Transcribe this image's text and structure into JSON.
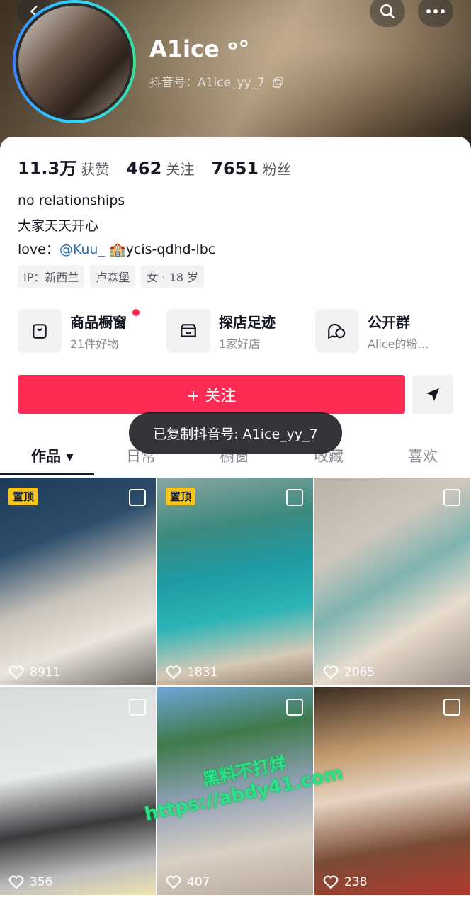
{
  "profile": {
    "name": "A1ice ᵒ°",
    "uid_label": "抖音号：",
    "uid": "A1ice_yy_7",
    "stats": [
      {
        "num": "11.3万",
        "label": "获赞"
      },
      {
        "num": "462",
        "label": "关注"
      },
      {
        "num": "7651",
        "label": "粉丝"
      }
    ],
    "bio_line1": "no relationships",
    "bio_line2": "大家天天开心",
    "bio_love_prefix": "love：",
    "bio_mention": "@Kuu_",
    "bio_love_suffix": "🏫ycis-qdhd-lbc",
    "tags": [
      "IP：新西兰",
      "卢森堡",
      "女 · 18 岁"
    ]
  },
  "features": [
    {
      "title": "商品橱窗",
      "sub": "21件好物"
    },
    {
      "title": "探店足迹",
      "sub": "1家好店"
    },
    {
      "title": "公开群",
      "sub": "Alice的粉…"
    }
  ],
  "actions": {
    "follow": "+ 关注"
  },
  "toast": "已复制抖音号: A1ice_yy_7",
  "tabs": [
    "作品 ▾",
    "日常",
    "橱窗",
    "收藏",
    "喜欢"
  ],
  "videos": [
    {
      "likes": "8911",
      "pinned": "置顶"
    },
    {
      "likes": "1831",
      "pinned": "置顶"
    },
    {
      "likes": "2065",
      "pinned": ""
    },
    {
      "likes": "356",
      "pinned": ""
    },
    {
      "likes": "407",
      "pinned": ""
    },
    {
      "likes": "238",
      "pinned": ""
    }
  ],
  "watermark": {
    "line1": "黑料不打烊",
    "line2": "https://abdy41.com"
  },
  "colors": {
    "accent": "#fe2c55",
    "pin": "#f7c51d"
  }
}
